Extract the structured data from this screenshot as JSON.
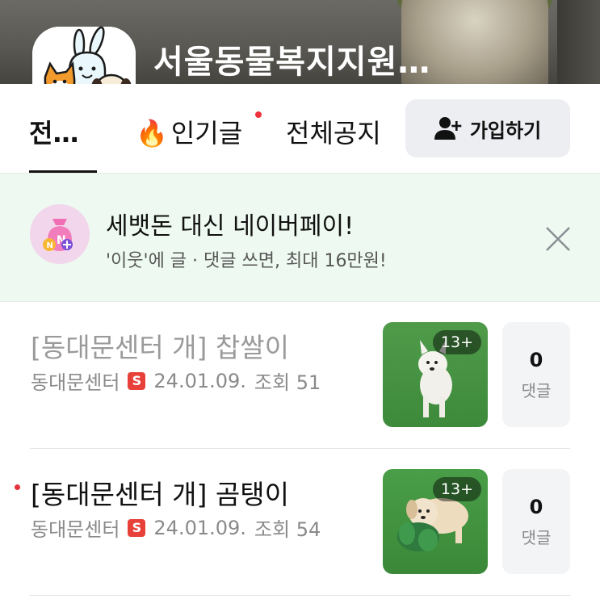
{
  "cafe": {
    "title": "서울동물복지지원…"
  },
  "tabs": [
    {
      "label": "전…",
      "active": true
    },
    {
      "label": "인기글",
      "icon": "fire-icon",
      "has_new_dot": true
    },
    {
      "label": "전체공지"
    }
  ],
  "join_button": {
    "label": "가입하기",
    "icon": "person-add-icon"
  },
  "promo": {
    "title": "세뱃돈 대신 네이버페이!",
    "subtitle": "'이웃'에 글 · 댓글 쓰면, 최대 16만원!",
    "icon": "money-bag-icon"
  },
  "posts": [
    {
      "title": "[동대문센터 개] 찹쌀이",
      "author": "동대문센터",
      "staff_badge": "S",
      "date": "24.01.09.",
      "views": "조회 51",
      "image_count": "13+",
      "comment_count": "0",
      "comment_label": "댓글",
      "read": true
    },
    {
      "title": "[동대문센터 개] 곰탱이",
      "author": "동대문센터",
      "staff_badge": "S",
      "date": "24.01.09.",
      "views": "조회 54",
      "image_count": "13+",
      "comment_count": "0",
      "comment_label": "댓글",
      "read": false
    }
  ],
  "colors": {
    "promo_bg": "#eefaf1",
    "join_bg": "#edeef1",
    "new_dot": "#f0323c",
    "staff_badge": "#e8413a"
  }
}
